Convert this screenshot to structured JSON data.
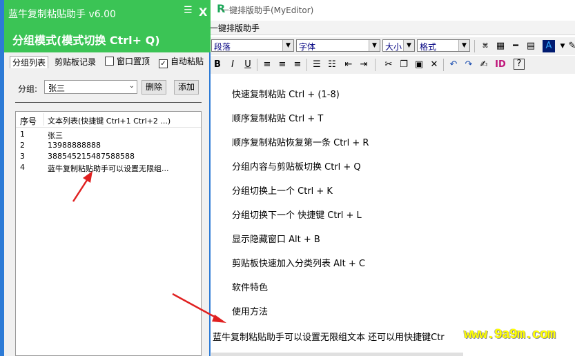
{
  "editor": {
    "title": "一键排版助手(MyEditor)",
    "menu_label": "一键排版助手",
    "paragraph_combo": "段落",
    "font_combo": "字体",
    "size_combo": "大小",
    "format_combo": "格式",
    "lines": [
      "快速复制粘贴 Ctrl + (1-8)",
      "顺序复制粘贴 Ctrl + T",
      "顺序复制粘贴恢复第一条 Ctrl + R",
      "分组内容与剪贴板切换 Ctrl + Q",
      "分组切换上一个 Ctrl + K",
      "分组切换下一个 快捷键 Ctrl + L",
      "显示隐藏窗口 Alt + B",
      "剪贴板快速加入分类列表 Alt + C",
      "软件特色",
      "使用方法"
    ],
    "last_line": "蓝牛复制粘贴助手可以设置无限组文本 还可以用快捷键Ctr"
  },
  "watermark": "www.9a9m.com",
  "helper": {
    "title": "蓝牛复制粘贴助手 v6.00",
    "close": "X",
    "mode_text": "分组模式(模式切换 Ctrl+ Q)",
    "tabs": [
      "分组列表",
      "剪贴板记录"
    ],
    "checkbox_top": "窗口置顶",
    "checkbox_autopaste": "自动粘贴",
    "group_label": "分组:",
    "group_value": "张三",
    "delete_button": "删除",
    "add_button": "添加",
    "list_header_no": "序号",
    "list_header_text": "文本列表(快捷键 Ctrl+1 Ctrl+2 ...)",
    "rows": [
      {
        "no": "1",
        "text": "张三"
      },
      {
        "no": "2",
        "text": "13988888888"
      },
      {
        "no": "3",
        "text": "388545215487588588"
      },
      {
        "no": "4",
        "text": "蓝牛复制粘贴助手可以设置无限组..."
      }
    ]
  },
  "colors": {
    "helper_green": "#3bc455",
    "helper_blue_border": "#2d7bd6",
    "arrow_red": "#e02020",
    "watermark_yellow": "#ffff00"
  }
}
